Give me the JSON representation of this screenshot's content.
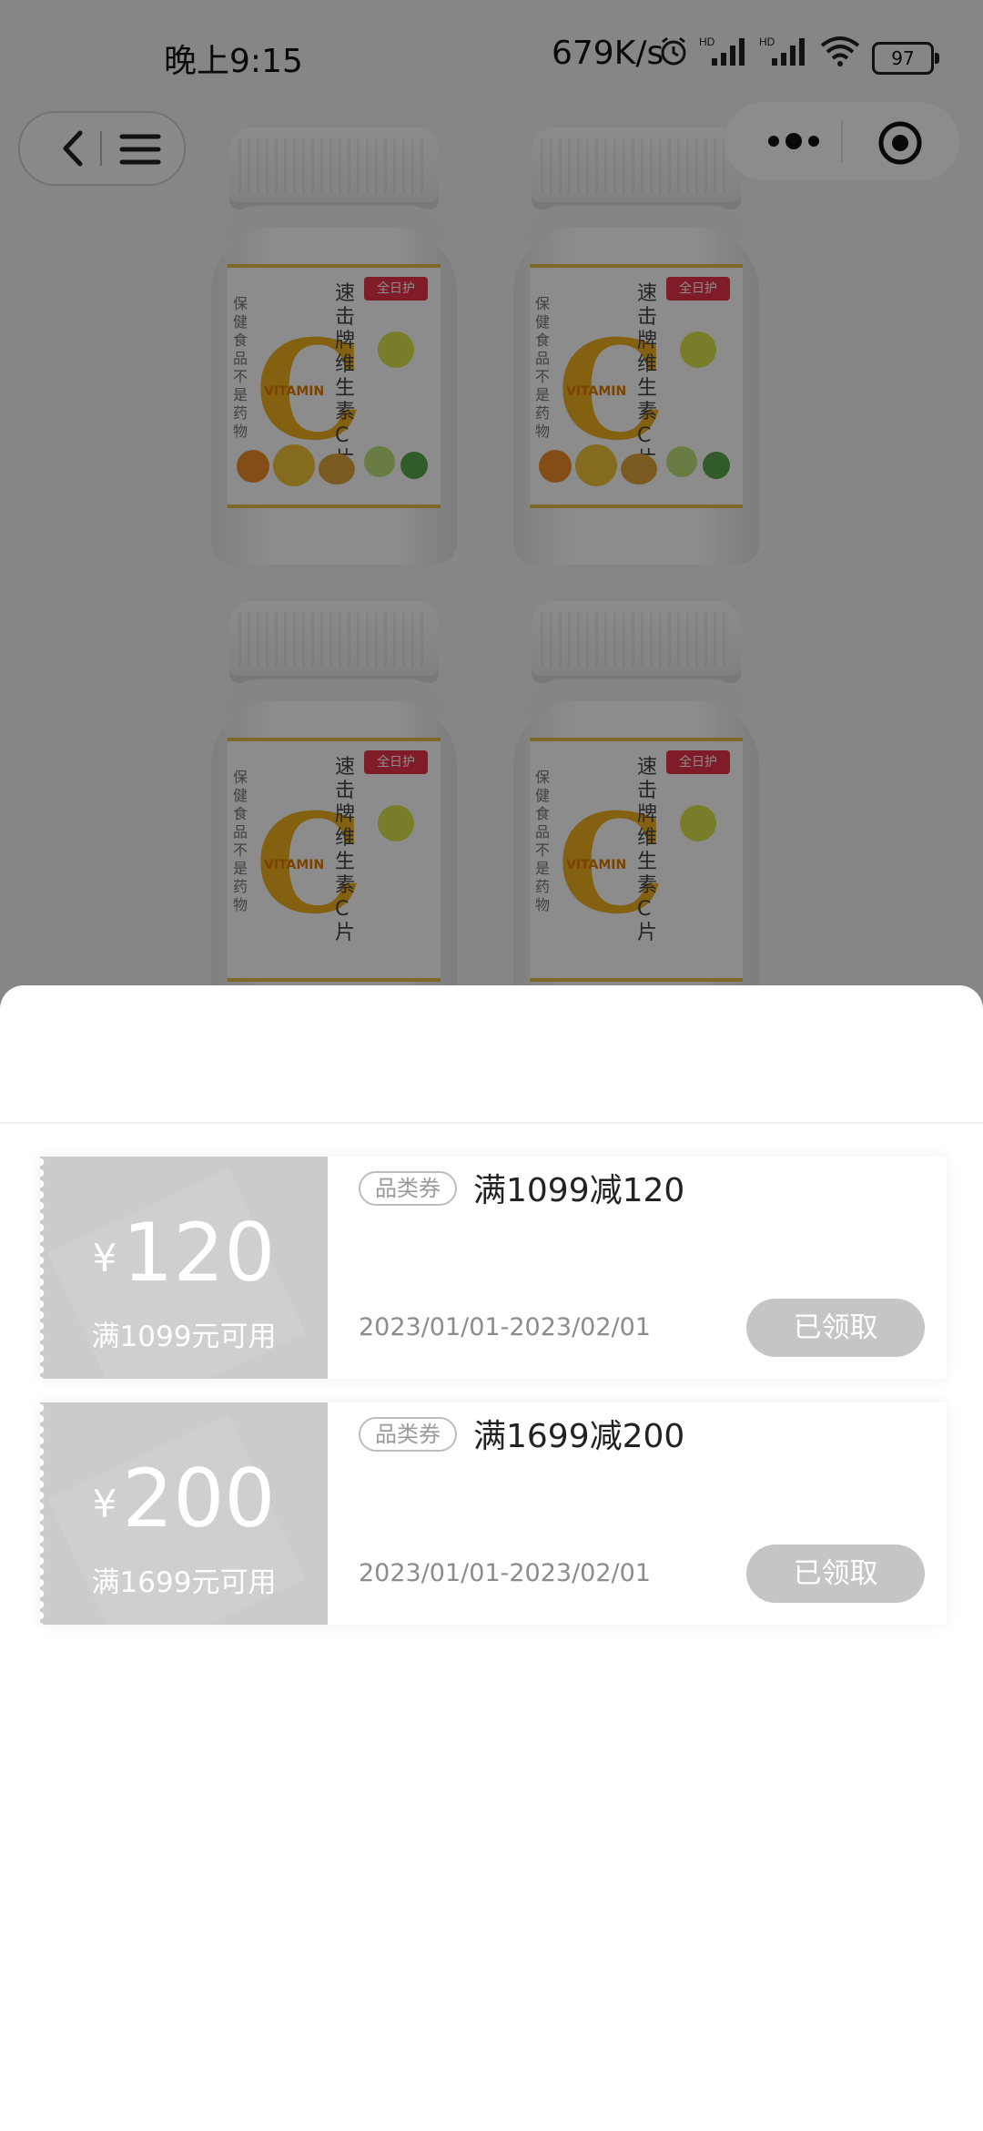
{
  "status_bar": {
    "time": "晚上9:15",
    "net_speed": "679K/s",
    "battery": "97",
    "icons": [
      "alarm-icon",
      "hd-signal-icon",
      "hd-signal-icon",
      "wifi-icon",
      "battery-icon"
    ]
  },
  "product": {
    "brand_text": "速击牌维生素C片",
    "tag": "全日护",
    "c_letter": "C",
    "vitamin_text": "VITAMIN",
    "side_text": "保健食品不是药物"
  },
  "coupons": [
    {
      "yen": "¥",
      "amount": "120",
      "condition": "满1099元可用",
      "badge": "品类券",
      "title": "满1099减120",
      "date": "2023/01/01-2023/02/01",
      "button": "已领取"
    },
    {
      "yen": "¥",
      "amount": "200",
      "condition": "满1699元可用",
      "badge": "品类券",
      "title": "满1699减200",
      "date": "2023/01/01-2023/02/01",
      "button": "已领取"
    }
  ],
  "colors": {
    "coupon_left_bg": "#cbcbcb",
    "claimed_button_bg": "#c5c5c5",
    "tag_red": "#e8334a",
    "vitamin_yellow": "#f0b020"
  }
}
